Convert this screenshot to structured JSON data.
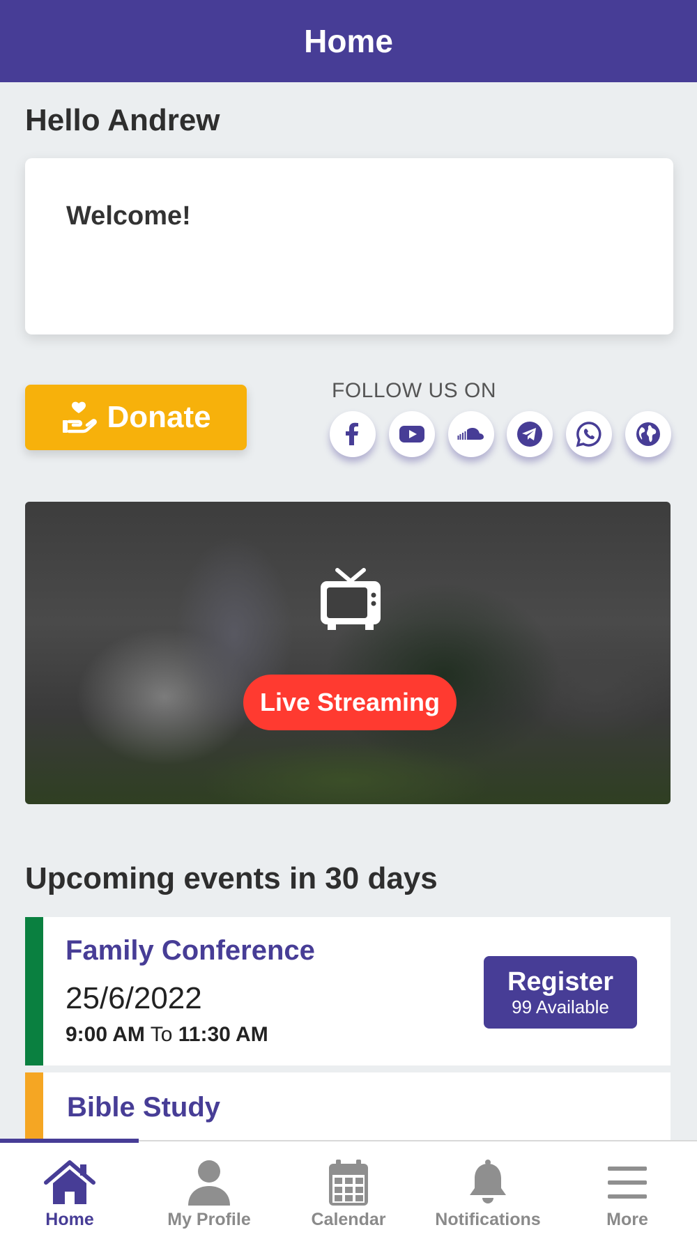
{
  "header": {
    "title": "Home"
  },
  "greeting": "Hello Andrew",
  "welcome_card": {
    "text": "Welcome!"
  },
  "donate": {
    "label": "Donate",
    "icon": "hand-heart-icon"
  },
  "follow": {
    "label": "FOLLOW US ON",
    "items": [
      {
        "name": "facebook",
        "icon": "facebook-icon"
      },
      {
        "name": "youtube",
        "icon": "youtube-icon"
      },
      {
        "name": "soundcloud",
        "icon": "soundcloud-icon"
      },
      {
        "name": "telegram",
        "icon": "telegram-icon"
      },
      {
        "name": "whatsapp",
        "icon": "whatsapp-icon"
      },
      {
        "name": "website",
        "icon": "globe-icon"
      }
    ]
  },
  "live": {
    "label": "Live Streaming",
    "icon": "tv-icon"
  },
  "events": {
    "title": "Upcoming events in 30 days",
    "items": [
      {
        "name": "Family Conference",
        "date": "25/6/2022",
        "start": "9:00 AM",
        "to": "To",
        "end": "11:30 AM",
        "register_label": "Register",
        "available": "99 Available",
        "accent": "#0A8040"
      },
      {
        "name": "Bible Study",
        "accent": "#F5A623"
      }
    ]
  },
  "tabs": [
    {
      "label": "Home",
      "icon": "home-icon",
      "active": true
    },
    {
      "label": "My Profile",
      "icon": "user-icon",
      "active": false
    },
    {
      "label": "Calendar",
      "icon": "calendar-icon",
      "active": false
    },
    {
      "label": "Notifications",
      "icon": "bell-icon",
      "active": false
    },
    {
      "label": "More",
      "icon": "menu-icon",
      "active": false
    }
  ],
  "colors": {
    "primary": "#473D96",
    "donate": "#F7B10B",
    "live": "#FF3A30",
    "background": "#EBEEF0"
  }
}
